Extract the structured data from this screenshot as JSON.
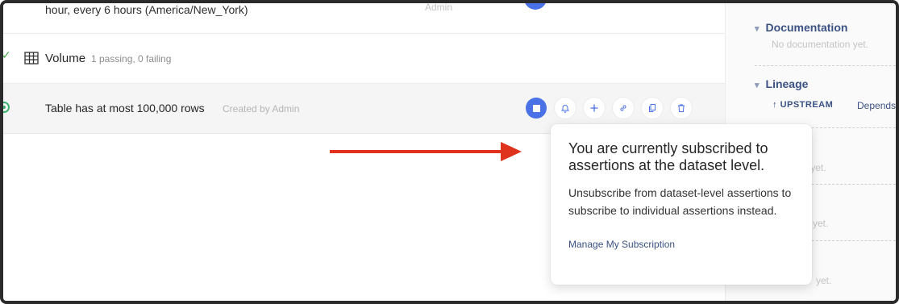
{
  "rows": {
    "schedule": {
      "text": "hour, every 6 hours (America/New_York)",
      "admin": "Admin"
    },
    "volume": {
      "name": "Volume",
      "meta": "1 passing, 0 failing"
    },
    "assertion": {
      "name": "Table has at most 100,000 rows",
      "created": "Created by Admin"
    }
  },
  "actions": [
    "stop-subscription",
    "notifications",
    "add",
    "link",
    "copy",
    "delete"
  ],
  "sidebar": {
    "documentation": {
      "title": "Documentation",
      "empty": "No documentation yet."
    },
    "lineage": {
      "title": "Lineage",
      "upstream": "UPSTREAM",
      "depends": "Depends"
    },
    "fragments": [
      "rs yet.",
      "yet.",
      "yet."
    ]
  },
  "tooltip": {
    "title": "You are currently subscribed to assertions at the dataset level.",
    "body": "Unsubscribe from dataset-level assertions to subscribe to individual assertions instead.",
    "link": "Manage My Subscription"
  },
  "colors": {
    "accent": "#4a72e6",
    "arrow": "#e0331e",
    "success": "#3cb371",
    "link": "#3b5284"
  }
}
